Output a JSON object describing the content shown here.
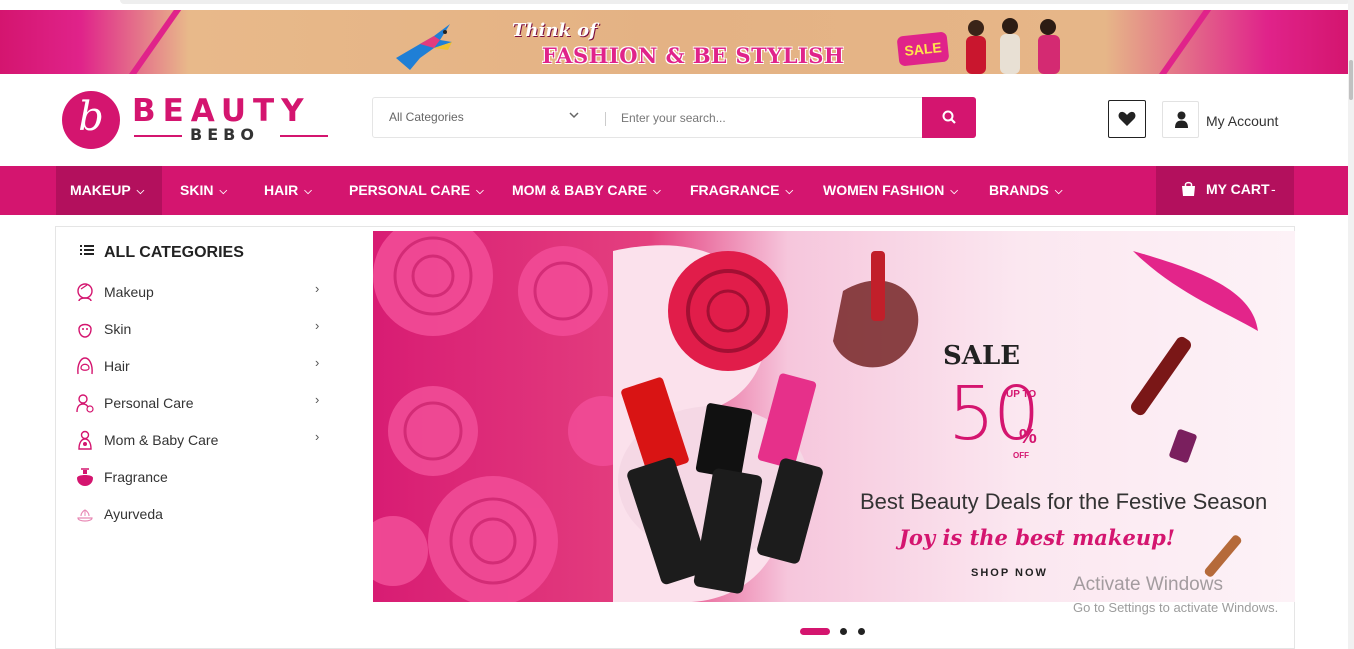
{
  "banner": {
    "think": "Think of",
    "headline": "FASHION & BE STYLISH",
    "badge": "SALE"
  },
  "logo": {
    "mark": "b",
    "word1": "BEAUTY",
    "word2": "BEBO"
  },
  "search": {
    "category_selected": "All Categories",
    "placeholder": "Enter your search...",
    "button_icon": "search-icon"
  },
  "header": {
    "wishlist_icon": "heart-icon",
    "account_icon": "user-icon",
    "account_label": "My Account"
  },
  "nav": {
    "items": [
      {
        "label": "MAKEUP",
        "active": true
      },
      {
        "label": "SKIN"
      },
      {
        "label": "HAIR"
      },
      {
        "label": "PERSONAL CARE"
      },
      {
        "label": "MOM & BABY CARE"
      },
      {
        "label": "FRAGRANCE"
      },
      {
        "label": "WOMEN FASHION"
      },
      {
        "label": "BRANDS"
      }
    ],
    "cart_label": "MY CART",
    "cart_suffix": "-"
  },
  "sidebar": {
    "title": "ALL CATEGORIES",
    "items": [
      {
        "label": "Makeup",
        "has_submenu": true
      },
      {
        "label": "Skin",
        "has_submenu": true
      },
      {
        "label": "Hair",
        "has_submenu": true
      },
      {
        "label": "Personal Care",
        "has_submenu": true
      },
      {
        "label": "Mom & Baby Care",
        "has_submenu": true
      },
      {
        "label": "Fragrance",
        "has_submenu": false
      },
      {
        "label": "Ayurveda",
        "has_submenu": false
      }
    ]
  },
  "hero": {
    "sale": "SALE",
    "upto": "UP TO",
    "value": "50",
    "percent": "%",
    "off": "OFF",
    "deals": "Best Beauty Deals for the Festive Season",
    "tagline": "Joy is the best makeup!",
    "cta": "SHOP NOW"
  },
  "carousel": {
    "slides": 3,
    "active": 1
  },
  "watermark": {
    "line1": "Activate Windows",
    "line2": "Go to Settings to activate Windows."
  },
  "colors": {
    "brand": "#d4156f",
    "brand_dark": "#b3105d"
  }
}
